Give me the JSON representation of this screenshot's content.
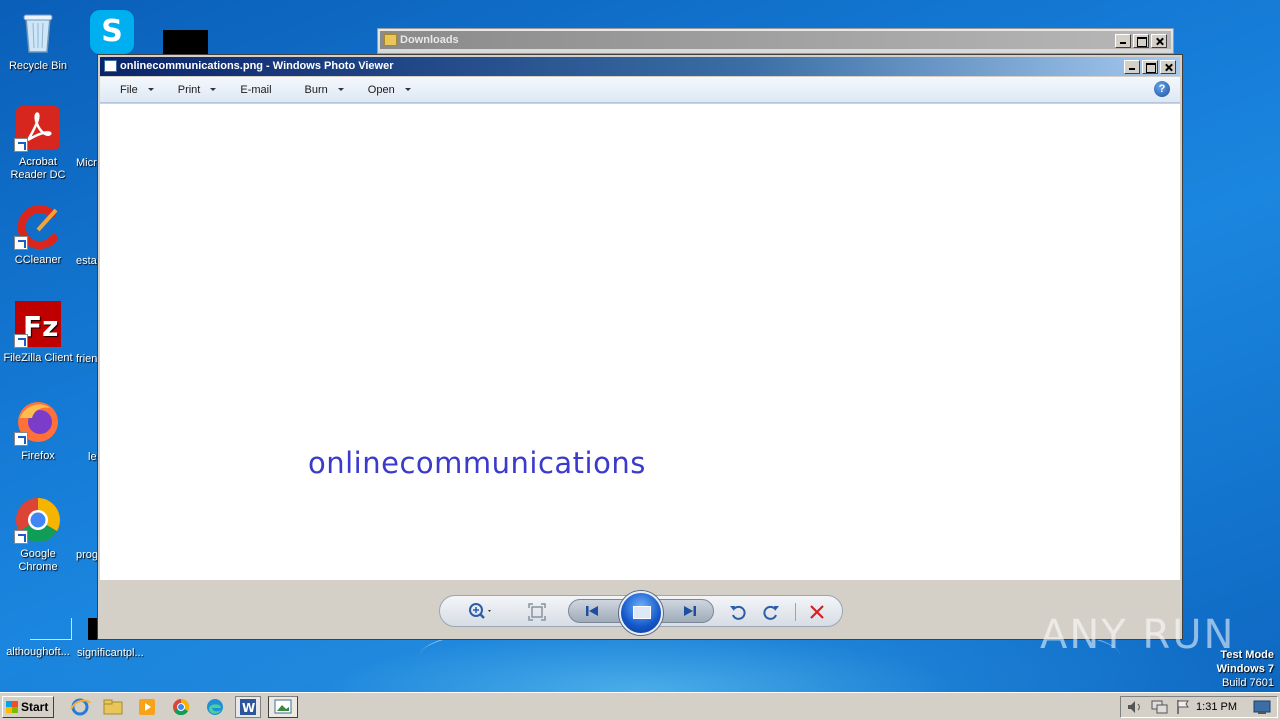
{
  "desktop": {
    "icons": [
      {
        "label": "Recycle Bin"
      },
      {
        "label": "Acrobat Reader DC"
      },
      {
        "label": "CCleaner"
      },
      {
        "label": "FileZilla Client"
      },
      {
        "label": "Firefox"
      },
      {
        "label": "Google Chrome"
      },
      {
        "label": "althoughoft..."
      }
    ],
    "partial_labels": [
      "Micr",
      "esta",
      "frien",
      "le",
      "prog",
      "significantpl..."
    ]
  },
  "downloads_window": {
    "title": "Downloads"
  },
  "viewer": {
    "title": "onlinecommunications.png - Windows Photo Viewer",
    "menu": [
      {
        "label": "File",
        "has_dropdown": true
      },
      {
        "label": "Print",
        "has_dropdown": true
      },
      {
        "label": "E-mail",
        "has_dropdown": false
      },
      {
        "label": "Burn",
        "has_dropdown": true
      },
      {
        "label": "Open",
        "has_dropdown": true
      }
    ],
    "help_label": "?",
    "image_text": "onlinecommunications"
  },
  "watermark": "ANY RUN",
  "os_info": {
    "line1": "Test Mode",
    "line2": "Windows 7",
    "line3": "Build 7601"
  },
  "taskbar": {
    "start_label": "Start",
    "clock": "1:31 PM"
  },
  "colors": {
    "image_text": "#3a3acc",
    "title_active": "#0a246a"
  }
}
